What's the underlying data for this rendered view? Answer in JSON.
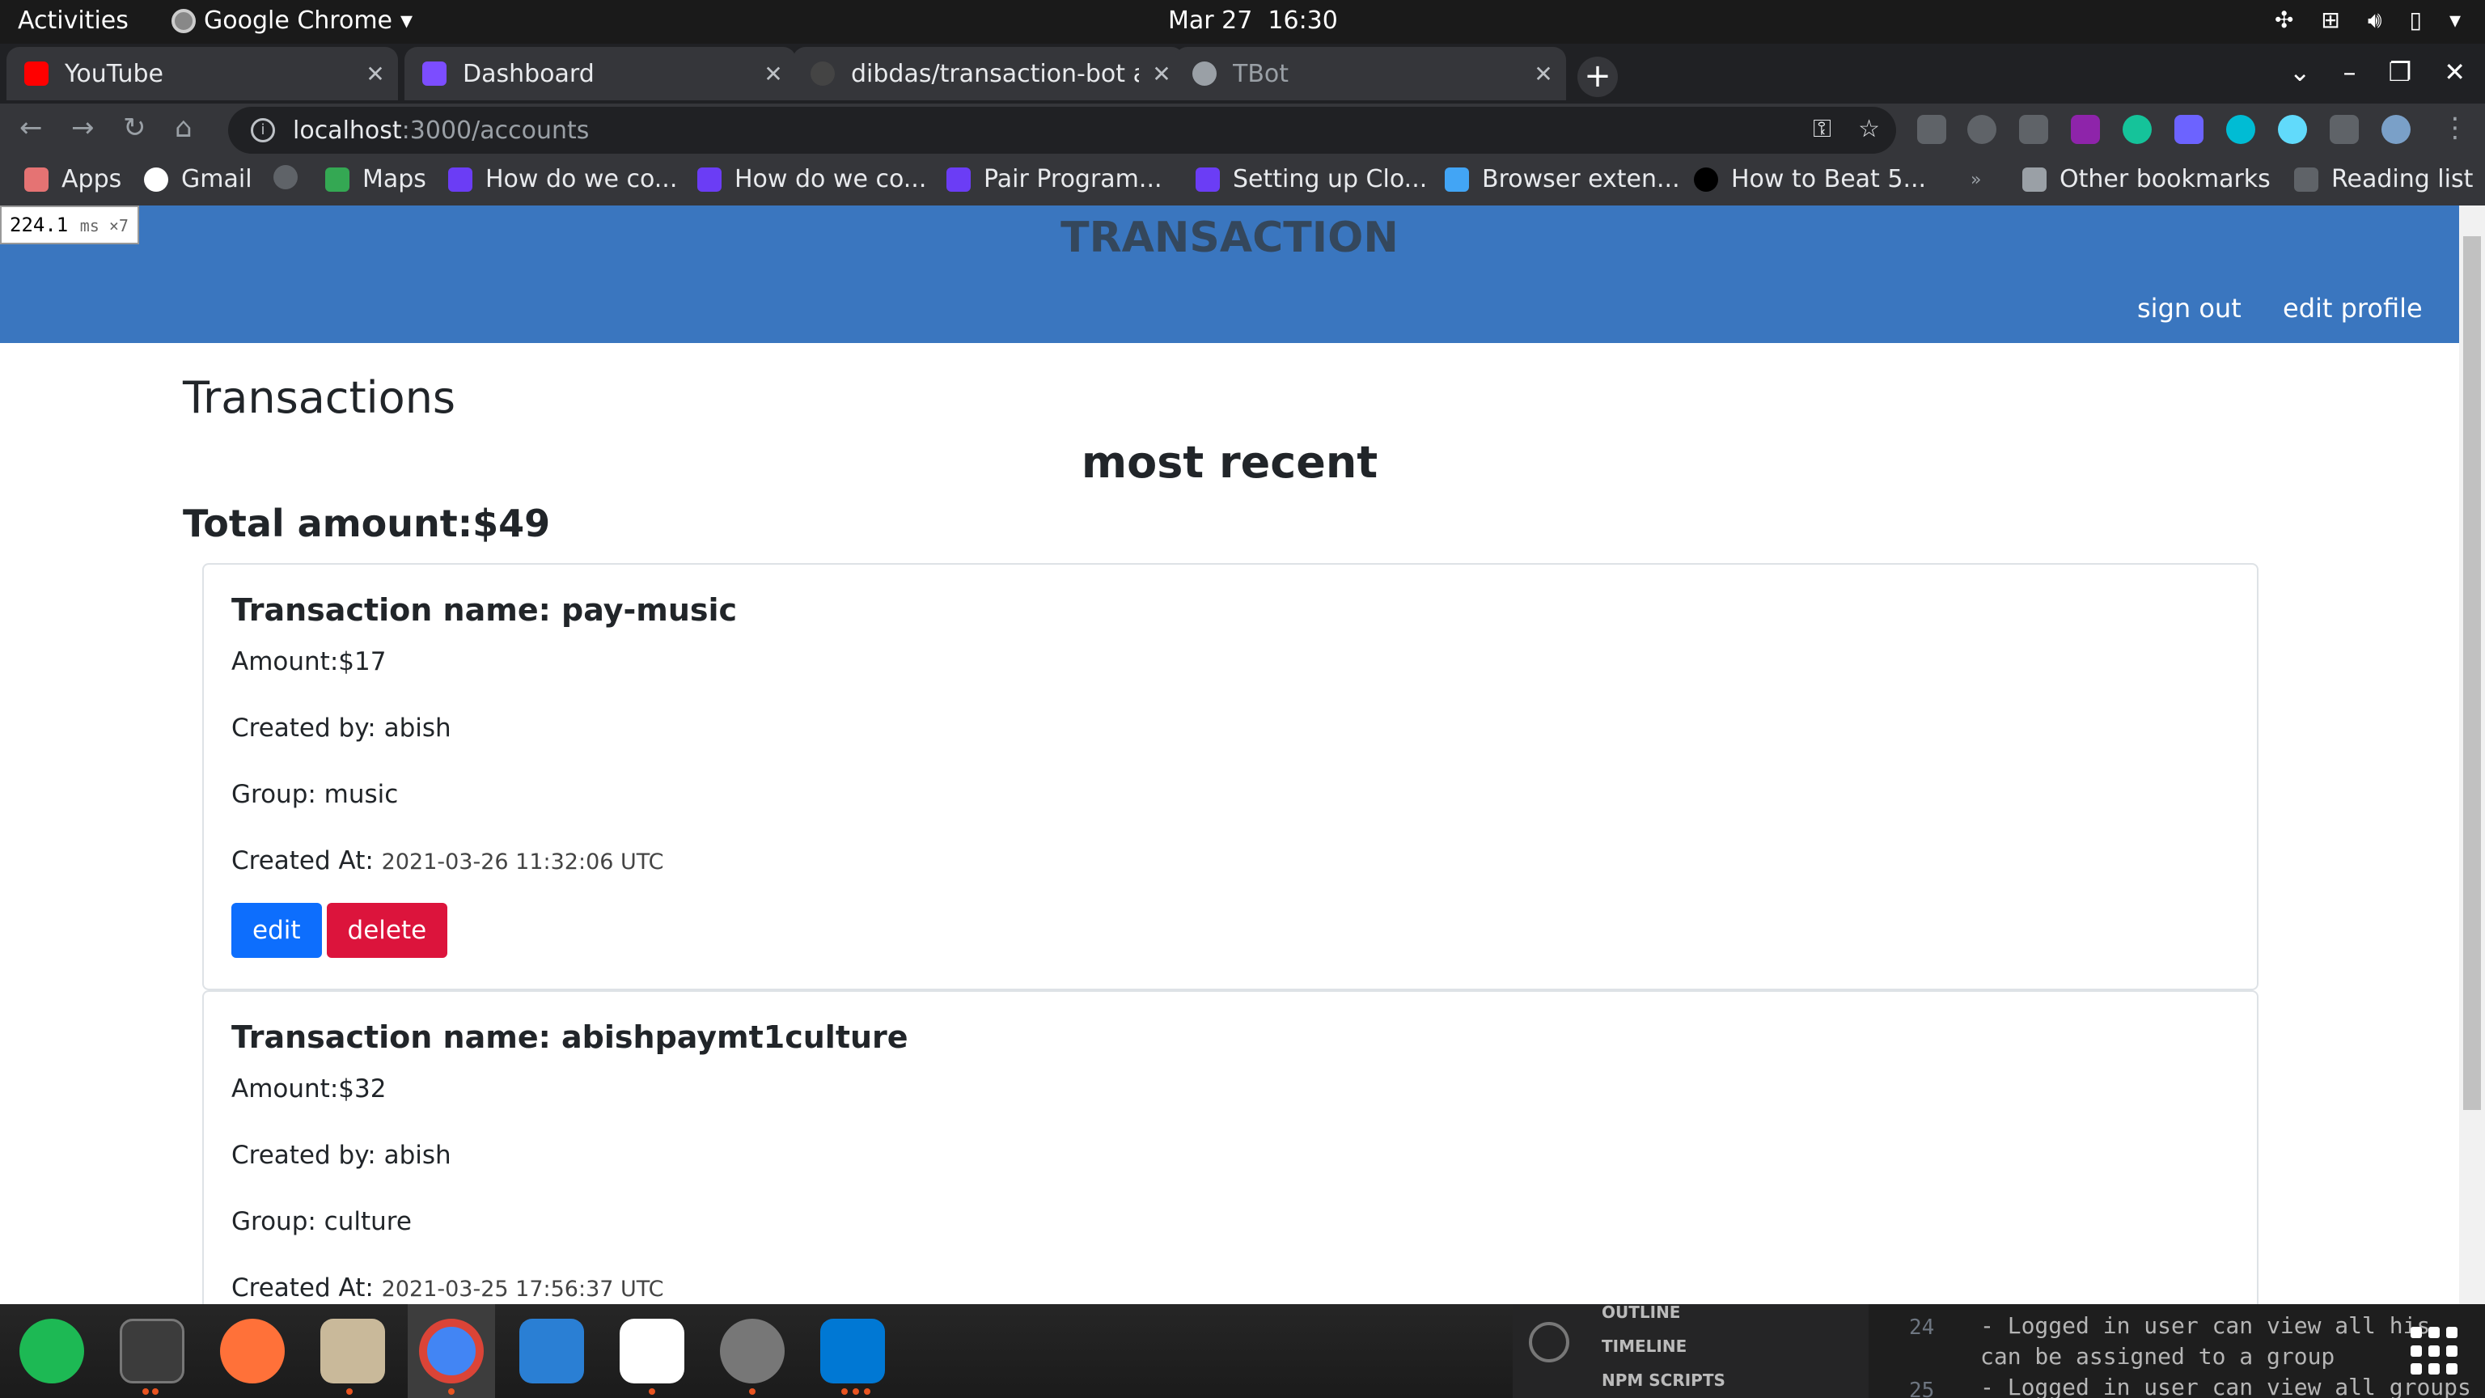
{
  "system_bar": {
    "activities": "Activities",
    "app_name": "Google Chrome",
    "date": "Mar 27",
    "time": "16:30"
  },
  "tabs": [
    {
      "label": "YouTube",
      "icon": "youtube-icon",
      "color": "#ff0000"
    },
    {
      "label": "Dashboard",
      "icon": "dashboard-icon",
      "color": "#7c4dff"
    },
    {
      "label": "dibdas/transaction-bot at",
      "icon": "github-icon",
      "color": "#444444"
    },
    {
      "label": "TBot",
      "icon": "globe-icon",
      "color": "#9aa0a6"
    }
  ],
  "address": {
    "host": "localhost",
    "path": ":3000/accounts"
  },
  "bookmarks": [
    {
      "label": "Apps",
      "icon": "apps-icon"
    },
    {
      "label": "Gmail",
      "icon": "google-icon"
    },
    {
      "label": "",
      "icon": "globe-icon"
    },
    {
      "label": "Maps",
      "icon": "maps-icon"
    },
    {
      "label": "How do we co...",
      "icon": "miro-icon"
    },
    {
      "label": "How do we co...",
      "icon": "miro-icon"
    },
    {
      "label": "Pair Program...",
      "icon": "miro-icon"
    },
    {
      "label": "Setting up Clo...",
      "icon": "miro-icon"
    },
    {
      "label": "Browser exten...",
      "icon": "flutter-icon"
    },
    {
      "label": "How to Beat 5...",
      "icon": "medium-icon"
    }
  ],
  "bookmarks_right": {
    "other": "Other bookmarks",
    "reading": "Reading list"
  },
  "perf_overlay": {
    "value": "224.1",
    "unit": "ms ×7"
  },
  "site": {
    "brand": "TRANSACTION",
    "nav": {
      "sign_out": "sign out",
      "edit_profile": "edit profile"
    },
    "heading": "Transactions",
    "subheading": "most recent",
    "total": "Total amount:$49"
  },
  "transactions": [
    {
      "name": "Transaction name: pay-music",
      "amount": "Amount:$17",
      "created_by": "Created by: abish",
      "group": "Group: music",
      "created_at_label": "Created At:",
      "created_at": "2021-03-26 11:32:06 UTC",
      "edit": "edit",
      "delete": "delete"
    },
    {
      "name": "Transaction name: abishpaymt1culture",
      "amount": "Amount:$32",
      "created_by": "Created by: abish",
      "group": "Group: culture",
      "created_at_label": "Created At:",
      "created_at": "2021-03-25 17:56:37 UTC"
    }
  ],
  "background_editor": {
    "panels": [
      "OUTLINE",
      "TIMELINE",
      "NPM SCRIPTS"
    ],
    "line_numbers": [
      "24",
      "25"
    ],
    "code_lines": [
      "- Logged in user can view all his",
      "can be assigned to a group",
      "- Logged in user can view all groups"
    ]
  },
  "dock_apps": [
    "spotify-icon",
    "terminal-icon",
    "firefox-icon",
    "files-icon",
    "chrome-icon",
    "writer-icon",
    "slack-icon",
    "settings-icon",
    "vscode-icon"
  ]
}
